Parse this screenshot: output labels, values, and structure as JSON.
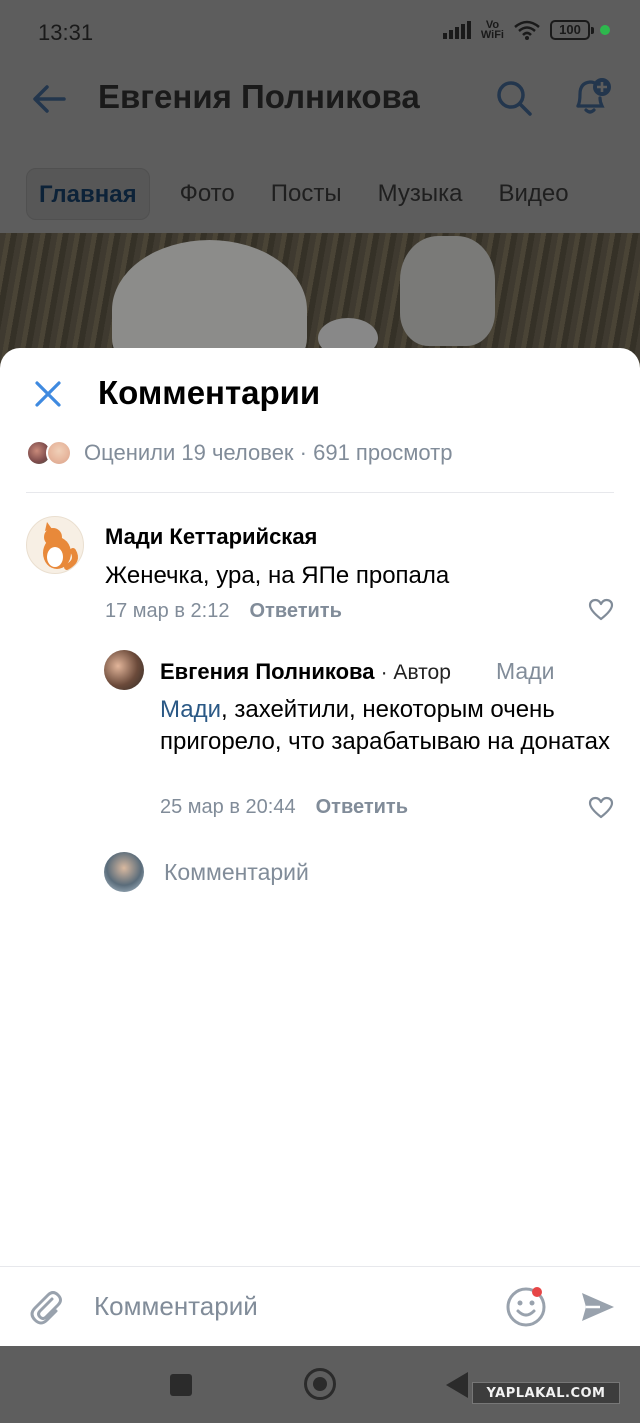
{
  "status_bar": {
    "time": "13:31",
    "network_label": "Vo\nWiFi",
    "battery": "100"
  },
  "profile": {
    "title": "Евгения Полникова",
    "tabs": [
      "Главная",
      "Фото",
      "Посты",
      "Музыка",
      "Видео"
    ],
    "active_tab": "Главная"
  },
  "comments_sheet": {
    "title": "Комментарии",
    "likes_text": "Оценили 19 человек · 691 просмотр",
    "comments": [
      {
        "author": "Мади Кеттарийская",
        "text": "Женечка, ура, на ЯПе пропала",
        "date": "17 мар в 2:12",
        "reply_label": "Ответить"
      },
      {
        "author": "Евгения Полникова",
        "author_badge": "· Автор",
        "reply_to": "Мади",
        "mention": "Мади",
        "text": ", захейтили, некоторым очень пригорело, что зарабатываю на донатах",
        "date": "25 мар в 20:44",
        "reply_label": "Ответить"
      }
    ],
    "reply_placeholder": "Комментарий"
  },
  "composer": {
    "placeholder": "Комментарий"
  },
  "watermark": "YAPLAKAL.COM",
  "colors": {
    "accent": "#2a5885",
    "secondary_text": "#818c99",
    "close_icon": "#3f8ae0",
    "notification_dot": "#e64646",
    "status_green": "#2db84d"
  }
}
